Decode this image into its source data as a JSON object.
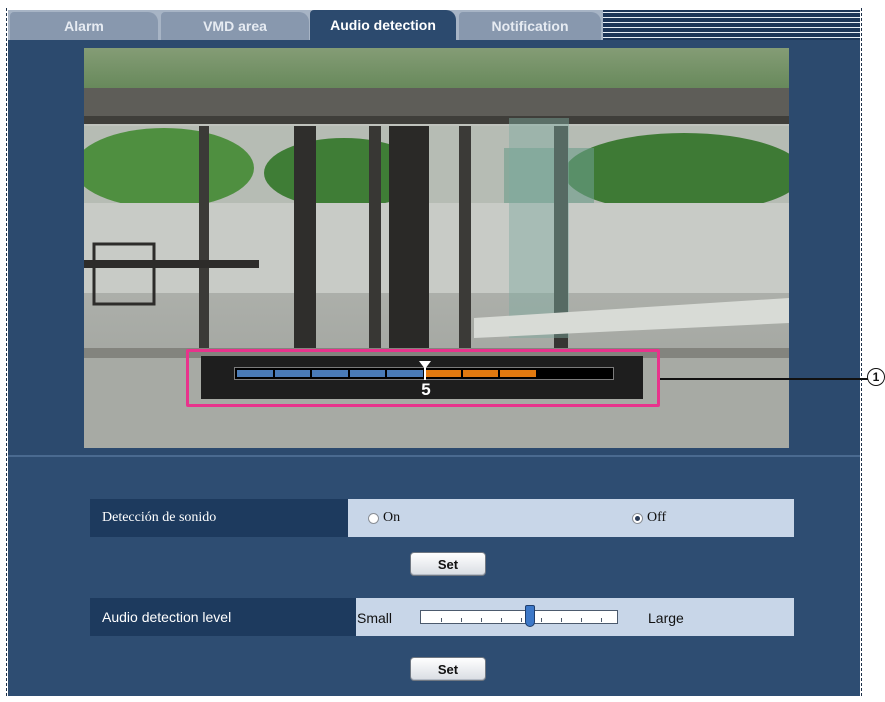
{
  "tabs": [
    {
      "label": "Alarm"
    },
    {
      "label": "VMD area"
    },
    {
      "label": "Audio detection",
      "active": true
    },
    {
      "label": "Notification"
    }
  ],
  "meter": {
    "value_label": "5",
    "level": 5,
    "segments": 10,
    "blue_segments": 5,
    "orange_segments": 3,
    "colors": {
      "blue": "#4a7bb7",
      "orange": "#e27a10",
      "empty": "#000000"
    }
  },
  "callout": {
    "label": "1"
  },
  "settings": {
    "sound_detection": {
      "label": "Detección de sonido",
      "option_on": "On",
      "option_off": "Off",
      "selected": "Off"
    },
    "set_button_1": "Set",
    "audio_level": {
      "label": "Audio detection level",
      "min_label": "Small",
      "max_label": "Large",
      "value_fraction": 0.56
    },
    "set_button_2": "Set"
  },
  "colors": {
    "panel": "#2c4a6e",
    "label_bg": "#1d3a5e",
    "value_bg": "#c8d6e8",
    "highlight": "#e8338c"
  }
}
